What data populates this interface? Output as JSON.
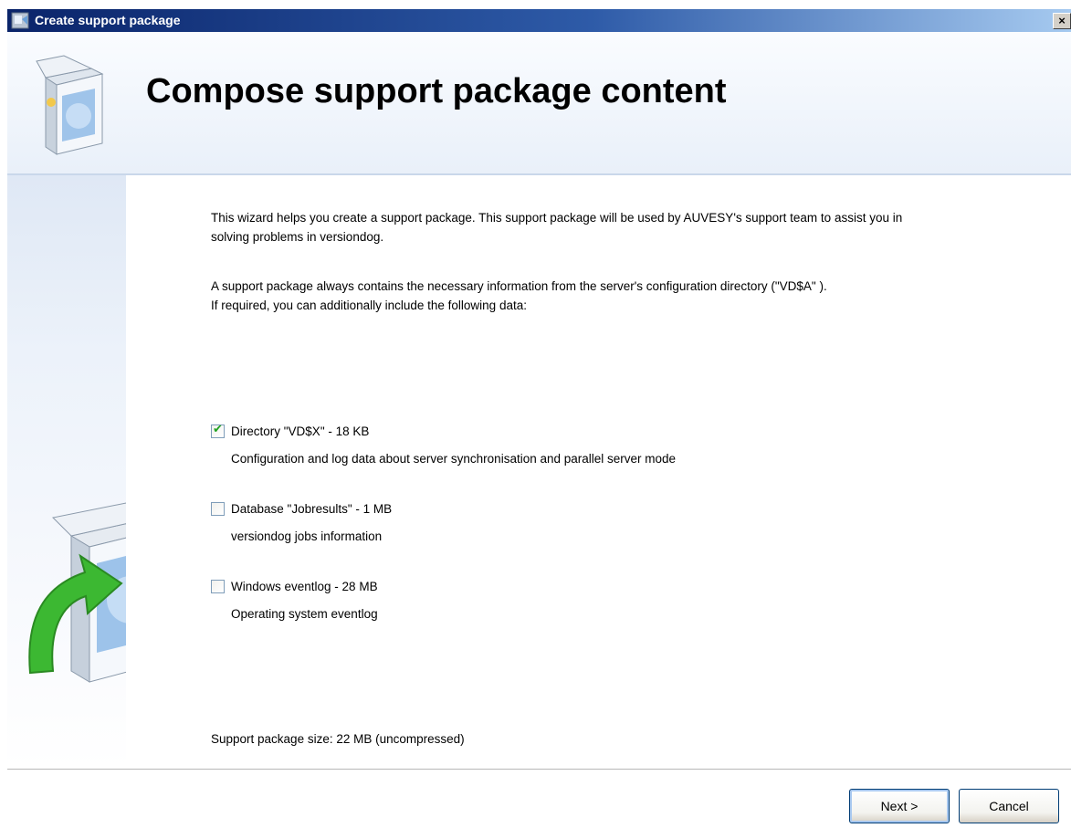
{
  "window": {
    "title": "Create support package",
    "close_glyph": "×"
  },
  "header": {
    "title": "Compose support package content",
    "icon": "package-box-icon"
  },
  "sidebar": {
    "icon": "package-upload-arrow-icon"
  },
  "content": {
    "intro_line1": "This wizard helps you create a support package. This support package will be used by AUVESY's support team to assist you in",
    "intro_line2": "solving problems in versiondog.",
    "info_line1": "A support package always contains the necessary information from the server's configuration directory (\"VD$A\" ).",
    "info_line2": "If required, you can additionally include the following data:",
    "options": [
      {
        "label": "Directory \"VD$X\" - 18 KB",
        "description": "Configuration and log data about server synchronisation and parallel server mode",
        "checked": true
      },
      {
        "label": "Database \"Jobresults\" - 1 MB",
        "description": "versiondog jobs information",
        "checked": false
      },
      {
        "label": "Windows eventlog - 28 MB",
        "description": "Operating system eventlog",
        "checked": false
      }
    ],
    "package_size": "Support package size: 22 MB (uncompressed)"
  },
  "footer": {
    "next_label": "Next >",
    "cancel_label": "Cancel"
  },
  "colors": {
    "titlebar_start": "#0a246a",
    "titlebar_end": "#a6caf0",
    "header_bg": "#e9f0f9",
    "checkmark": "#21a121",
    "arrow_green": "#3cb832"
  }
}
